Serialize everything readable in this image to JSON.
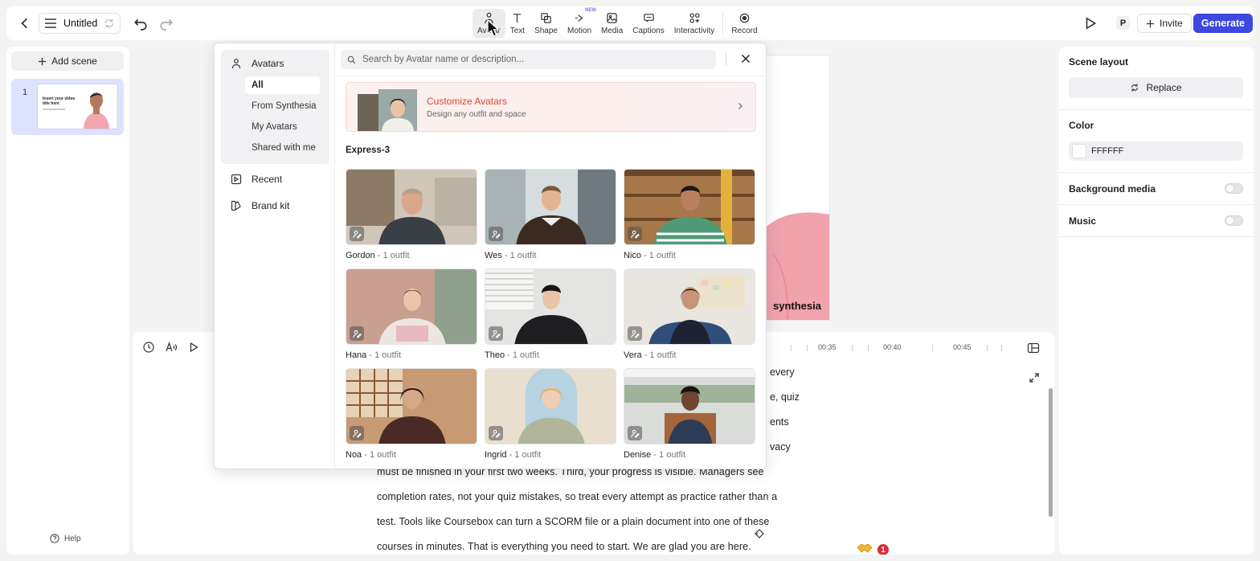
{
  "header": {
    "doc_title": "Untitled",
    "tools": [
      {
        "label": "Avatar",
        "icon": "avatar-icon",
        "active": true
      },
      {
        "label": "Text",
        "icon": "text-icon"
      },
      {
        "label": "Shape",
        "icon": "shape-icon"
      },
      {
        "label": "Motion",
        "icon": "motion-icon",
        "badge": "NEW"
      },
      {
        "label": "Media",
        "icon": "media-icon"
      },
      {
        "label": "Captions",
        "icon": "captions-icon"
      },
      {
        "label": "Interactivity",
        "icon": "interactivity-icon"
      },
      {
        "label": "Record",
        "icon": "record-icon"
      }
    ],
    "user_initial": "P",
    "invite_label": "Invite",
    "generate_label": "Generate"
  },
  "scenes": {
    "add_label": "Add scene",
    "items": [
      {
        "number": "1",
        "thumb_title": "Insert your video title here"
      }
    ],
    "help_label": "Help"
  },
  "canvas": {
    "logo_text": "synthesia"
  },
  "avatar_panel": {
    "nav_title": "Avatars",
    "sub_items": [
      "All",
      "From Synthesia",
      "My Avatars",
      "Shared with me"
    ],
    "recent_label": "Recent",
    "brand_kit_label": "Brand kit",
    "search_placeholder": "Search by Avatar name or description...",
    "banner_title": "Customize Avatars",
    "banner_subtitle": "Design any outfit and space",
    "section_title": "Express-3",
    "avatars": [
      {
        "name": "Gordon",
        "outfit": " - 1 outfit"
      },
      {
        "name": "Wes",
        "outfit": " - 1 outfit"
      },
      {
        "name": "Nico",
        "outfit": " - 1 outfit"
      },
      {
        "name": "Hana",
        "outfit": " - 1 outfit"
      },
      {
        "name": "Theo",
        "outfit": " - 1 outfit"
      },
      {
        "name": "Vera",
        "outfit": " - 1 outfit"
      },
      {
        "name": "Noa",
        "outfit": " - 1 outfit"
      },
      {
        "name": "Ingrid",
        "outfit": " - 1 outfit"
      },
      {
        "name": "Denise",
        "outfit": " - 1 outfit"
      }
    ]
  },
  "timeline": {
    "ticks": [
      "00:35",
      "00:40",
      "00:45"
    ]
  },
  "script": {
    "fragments": [
      "every",
      "e, quiz",
      "ents",
      "vacy"
    ],
    "lines": [
      "must be finished in your first two weeks. Third, your progress is visible. Managers see",
      "completion rates, not your quiz mistakes, so treat every attempt as practice rather than a",
      "test. Tools like Coursebox can turn a SCORM file or a plain document into one of these",
      "courses in minutes. That is everything you need to start. We are glad you are here."
    ],
    "notification_count": "1"
  },
  "properties": {
    "scene_layout_label": "Scene layout",
    "replace_label": "Replace",
    "color_label": "Color",
    "color_value": "FFFFFF",
    "background_media_label": "Background media",
    "music_label": "Music"
  },
  "colors": {
    "accent": "#3b49df",
    "banner_title": "#d2492f",
    "notification": "#d92b3a"
  }
}
